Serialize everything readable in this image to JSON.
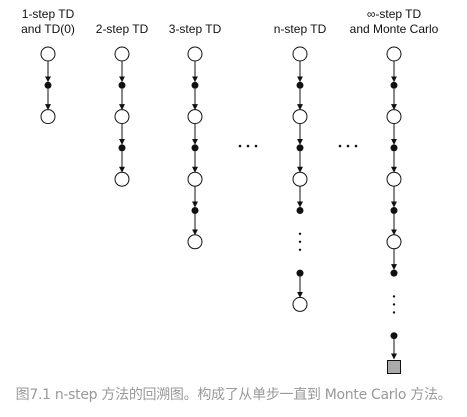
{
  "columns": [
    {
      "label_lines": [
        "1-step TD",
        "and TD(0)"
      ],
      "sequence": [
        "state",
        "action",
        "state"
      ]
    },
    {
      "label_lines": [
        "2-step TD"
      ],
      "sequence": [
        "state",
        "action",
        "state",
        "action",
        "state"
      ]
    },
    {
      "label_lines": [
        "3-step TD"
      ],
      "sequence": [
        "state",
        "action",
        "state",
        "action",
        "state",
        "action",
        "state"
      ]
    },
    {
      "label_lines": [
        "n-step TD"
      ],
      "sequence": [
        "state",
        "action",
        "state",
        "action",
        "state",
        "action",
        "vellipsis",
        "action",
        "state"
      ]
    },
    {
      "label_lines": [
        "∞-step TD",
        "and Monte Carlo"
      ],
      "sequence": [
        "state",
        "action",
        "state",
        "action",
        "state",
        "action",
        "state",
        "action",
        "vellipsis",
        "action",
        "terminal"
      ]
    }
  ],
  "caption": "图7.1 n-step 方法的回溯图。构成了从单步一直到 Monte Carlo 方法。",
  "colors": {
    "terminal_fill": "#aaaaaa",
    "caption": "#999999",
    "node_stroke": "#111111"
  }
}
